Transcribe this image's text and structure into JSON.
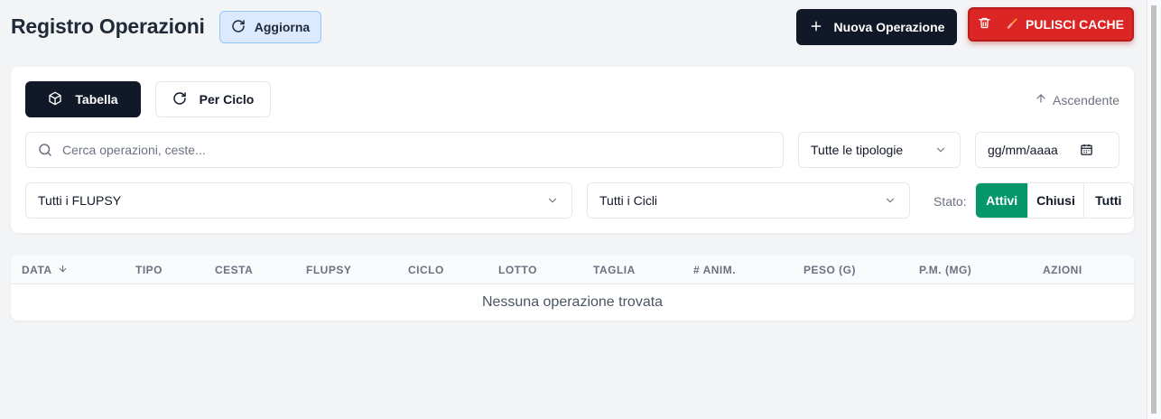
{
  "header": {
    "title": "Registro Operazioni",
    "refresh_label": "Aggiorna",
    "new_operation_label": "Nuova Operazione",
    "clear_cache_label": "PULISCI CACHE"
  },
  "filters": {
    "view_table_label": "Tabella",
    "view_cycle_label": "Per Ciclo",
    "sort_label": "Ascendente",
    "search_placeholder": "Cerca operazioni, ceste...",
    "type_select_value": "Tutte le tipologie",
    "date_placeholder": "gg/mm/aaaa",
    "flupsy_select_value": "Tutti i FLUPSY",
    "cycle_select_value": "Tutti i Cicli",
    "status_label": "Stato:",
    "status_options": [
      "Attivi",
      "Chiusi",
      "Tutti"
    ],
    "status_selected": "Attivi"
  },
  "table": {
    "columns": [
      "DATA",
      "TIPO",
      "CESTA",
      "FLUPSY",
      "CICLO",
      "LOTTO",
      "TAGLIA",
      "# ANIM.",
      "PESO (G)",
      "P.M. (MG)",
      "AZIONI"
    ],
    "sorted_column": "DATA",
    "sort_direction": "descending",
    "rows": [],
    "empty_message": "Nessuna operazione trovata"
  },
  "colors": {
    "primary_dark": "#111827",
    "refresh_bg": "#dbeafe",
    "danger": "#dc2626",
    "success": "#059669",
    "page_bg": "#f3f4f6"
  }
}
